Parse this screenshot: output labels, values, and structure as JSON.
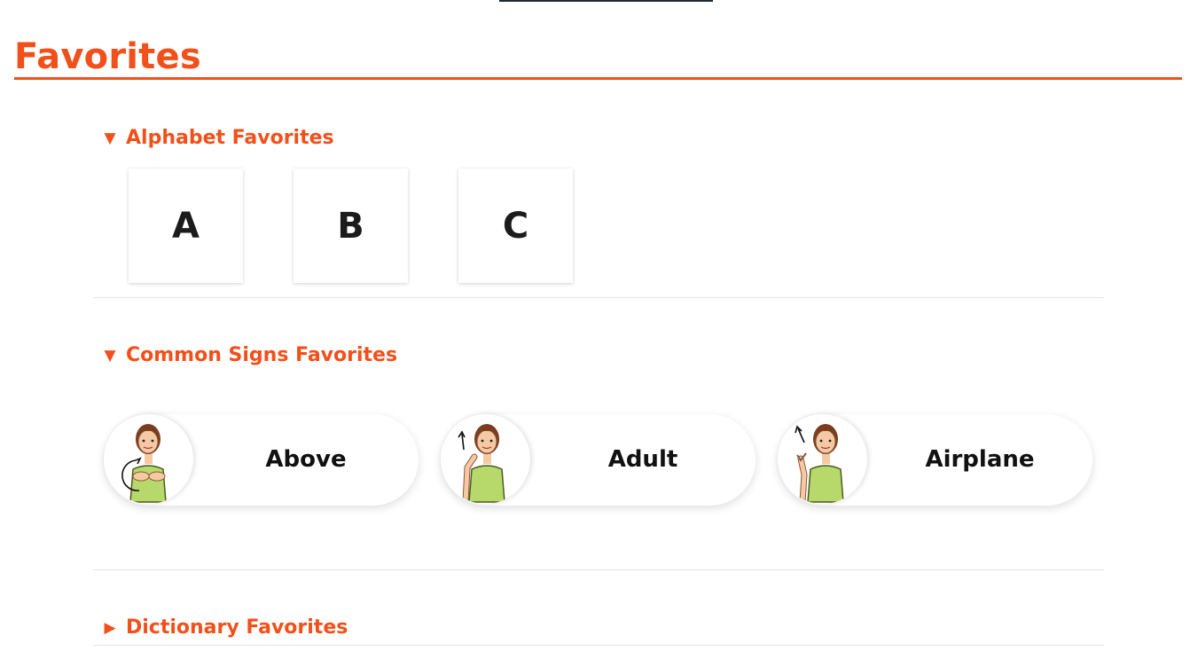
{
  "page": {
    "title": "Favorites"
  },
  "colors": {
    "accent": "#f2501a",
    "shirt": "#b7d86a",
    "hair": "#7a3e1e"
  },
  "sections": {
    "alphabet": {
      "title": "Alphabet Favorites",
      "expanded": true,
      "items": [
        "A",
        "B",
        "C"
      ]
    },
    "common_signs": {
      "title": "Common Signs Favorites",
      "expanded": true,
      "items": [
        {
          "label": "Above",
          "icon": "person-signing-above-icon"
        },
        {
          "label": "Adult",
          "icon": "person-signing-adult-icon"
        },
        {
          "label": "Airplane",
          "icon": "person-signing-airplane-icon"
        }
      ]
    },
    "dictionary": {
      "title": "Dictionary Favorites",
      "expanded": false
    }
  }
}
